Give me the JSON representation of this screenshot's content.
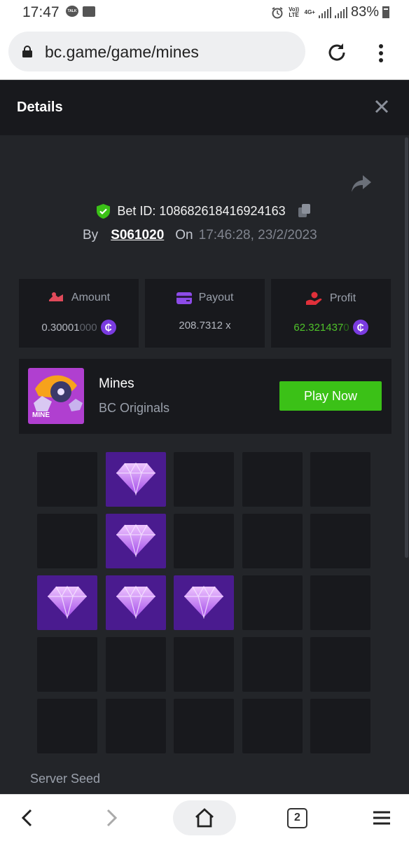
{
  "status_bar": {
    "time": "17:47",
    "notif_talk": "TALK",
    "network_volte": "Vo)) LTE",
    "network_4g": "4G+",
    "battery": "83%"
  },
  "browser": {
    "url": "bc.game/game/mines",
    "tab_count": "2"
  },
  "modal": {
    "title": "Details"
  },
  "bet": {
    "id_label": "Bet ID:",
    "id": "108682618416924163",
    "by_label": "By",
    "user": "S061020",
    "on_label": "On",
    "datetime": "17:46:28, 23/2/2023"
  },
  "stats": {
    "amount": {
      "label": "Amount",
      "value_main": "0.30001",
      "value_dim": "000"
    },
    "payout": {
      "label": "Payout",
      "value": "208.7312 x"
    },
    "profit": {
      "label": "Profit",
      "value_main": "62.321437",
      "value_dim": "0"
    },
    "coin_symbol": "₵"
  },
  "game": {
    "name": "Mines",
    "provider": "BC Originals",
    "thumb_label": "MINE",
    "play_label": "Play Now"
  },
  "grid": {
    "tiles": [
      "empty",
      "gem",
      "empty",
      "empty",
      "empty",
      "empty",
      "gem",
      "empty",
      "empty",
      "empty",
      "gem",
      "gem",
      "gem",
      "empty",
      "empty",
      "empty",
      "empty",
      "empty",
      "empty",
      "empty",
      "empty",
      "empty",
      "empty",
      "empty",
      "empty"
    ]
  },
  "sections": {
    "server_seed_label": "Server Seed"
  },
  "colors": {
    "accent_green": "#3bc117",
    "profit_green": "#4fc22a",
    "gem_tile": "#4a1b8f",
    "panel": "#18191d",
    "background": "#232529"
  }
}
